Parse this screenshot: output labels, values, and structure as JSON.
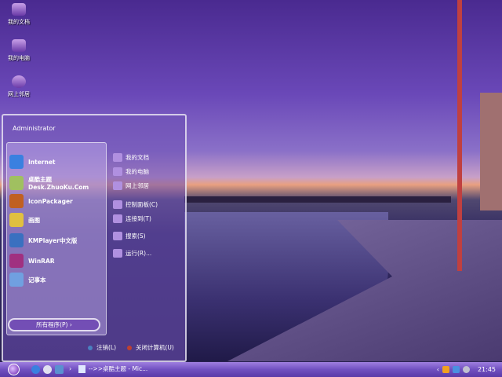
{
  "desktop": {
    "icons": [
      {
        "label": "我的文档",
        "icon": "my-documents-icon"
      },
      {
        "label": "我的电脑",
        "icon": "my-computer-icon"
      },
      {
        "label": "网上邻居",
        "icon": "network-icon"
      }
    ]
  },
  "start_menu": {
    "user": "Administrator",
    "pinned": [
      {
        "label": "Internet",
        "sub": "",
        "icon": "internet-explorer-icon",
        "color": "#3a80e0"
      },
      {
        "label": "桌酷主题",
        "sub": "Desk.ZhuoKu.Com",
        "icon": "zhuoku-icon",
        "color": "#a0c060"
      },
      {
        "label": "IconPackager",
        "sub": "",
        "icon": "iconpackager-icon",
        "color": "#c06020"
      },
      {
        "label": "画图",
        "sub": "",
        "icon": "paint-icon",
        "color": "#e0c040"
      },
      {
        "label": "KMPlayer中文版",
        "sub": "",
        "icon": "kmplayer-icon",
        "color": "#3a70c0"
      },
      {
        "label": "WinRAR",
        "sub": "",
        "icon": "winrar-icon",
        "color": "#a03080"
      },
      {
        "label": "记事本",
        "sub": "",
        "icon": "notepad-icon",
        "color": "#70a0e0"
      }
    ],
    "places": [
      {
        "label": "我的文档",
        "icon": "my-documents-icon"
      },
      {
        "label": "我的电脑",
        "icon": "my-computer-icon"
      },
      {
        "label": "网上邻居",
        "icon": "network-icon"
      },
      {
        "label": "控制面板(C)",
        "icon": "control-panel-icon"
      },
      {
        "label": "连接到(T)",
        "icon": "connect-icon"
      },
      {
        "label": "搜索(S)",
        "icon": "search-icon"
      },
      {
        "label": "运行(R)...",
        "icon": "run-icon"
      }
    ],
    "all_programs": "所有程序(P)",
    "logoff": "注销(L)",
    "shutdown": "关闭计算机(U)"
  },
  "taskbar": {
    "task": "-->>桌酷主题 - Mic...",
    "clock": "21:45",
    "arrow": "›",
    "tray_expand": "‹"
  }
}
